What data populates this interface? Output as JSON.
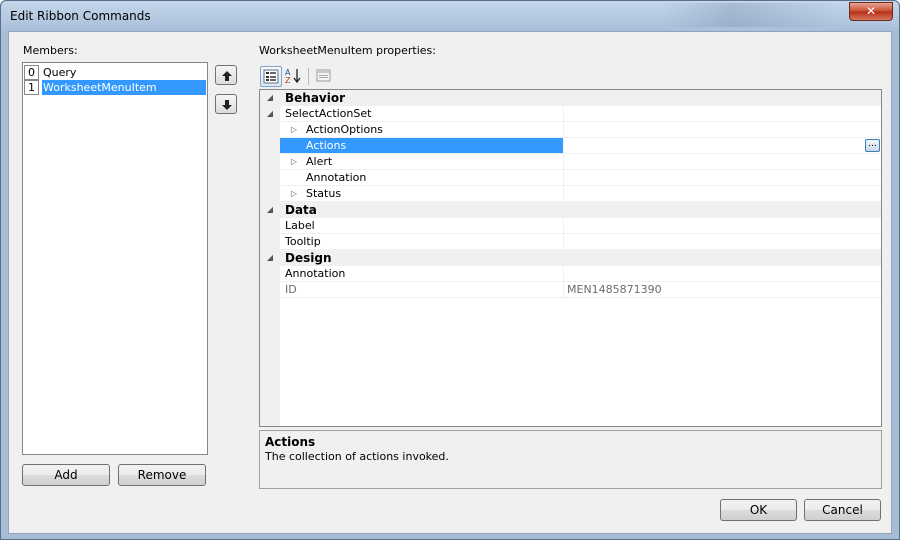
{
  "window": {
    "title": "Edit Ribbon Commands",
    "close_glyph": "✕"
  },
  "members": {
    "label": "Members:",
    "items": [
      {
        "index": "0",
        "name": "Query",
        "selected": false
      },
      {
        "index": "1",
        "name": "WorksheetMenuItem",
        "selected": true
      }
    ],
    "add_label": "Add",
    "remove_label": "Remove",
    "move_up_icon": "arrow-up-icon",
    "move_down_icon": "arrow-down-icon"
  },
  "properties": {
    "label": "WorksheetMenuItem properties:",
    "toolbar": [
      "categorized-icon",
      "alphabetical-icon",
      "property-pages-icon"
    ],
    "rows": [
      {
        "type": "category",
        "name": "Behavior",
        "expander": "◢"
      },
      {
        "type": "group",
        "name": "SelectActionSet",
        "expander": "◢",
        "value": ""
      },
      {
        "type": "sub",
        "name": "ActionOptions",
        "expander": "▷",
        "value": ""
      },
      {
        "type": "sub",
        "name": "Actions",
        "expander": "",
        "value": "",
        "selected": true,
        "ellipsis": "..."
      },
      {
        "type": "sub",
        "name": "Alert",
        "expander": "▷",
        "value": ""
      },
      {
        "type": "sub",
        "name": "Annotation",
        "expander": "",
        "value": ""
      },
      {
        "type": "sub",
        "name": "Status",
        "expander": "▷",
        "value": ""
      },
      {
        "type": "category",
        "name": "Data",
        "expander": "◢"
      },
      {
        "type": "prop",
        "name": "Label",
        "expander": "",
        "value": ""
      },
      {
        "type": "prop",
        "name": "Tooltip",
        "expander": "",
        "value": ""
      },
      {
        "type": "category",
        "name": "Design",
        "expander": "◢"
      },
      {
        "type": "prop",
        "name": "Annotation",
        "expander": "",
        "value": ""
      },
      {
        "type": "prop",
        "name": "ID",
        "expander": "",
        "value": "MEN1485871390",
        "readonly": true
      }
    ]
  },
  "help": {
    "title": "Actions",
    "description": "The collection of actions invoked."
  },
  "buttons": {
    "ok": "OK",
    "cancel": "Cancel"
  },
  "colors": {
    "selection": "#3399ff",
    "titlebar": "#b7cbe3",
    "close": "#c7492f"
  }
}
